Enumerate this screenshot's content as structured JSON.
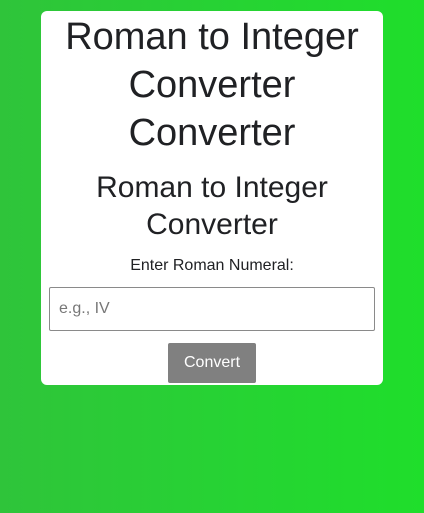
{
  "colors": {
    "background_left": "#2fc43a",
    "background_right": "#1fde2b",
    "card": "#ffffff",
    "button": "#808080"
  },
  "header": {
    "title_line1": "Roman to Integer",
    "title_line2": "Converter",
    "title_line3": "Converter"
  },
  "converter": {
    "heading_line1": "Roman to Integer",
    "heading_line2": "Converter",
    "input_label": "Enter Roman Numeral:",
    "input_value": "",
    "input_placeholder": "e.g., IV",
    "convert_label": "Convert"
  }
}
